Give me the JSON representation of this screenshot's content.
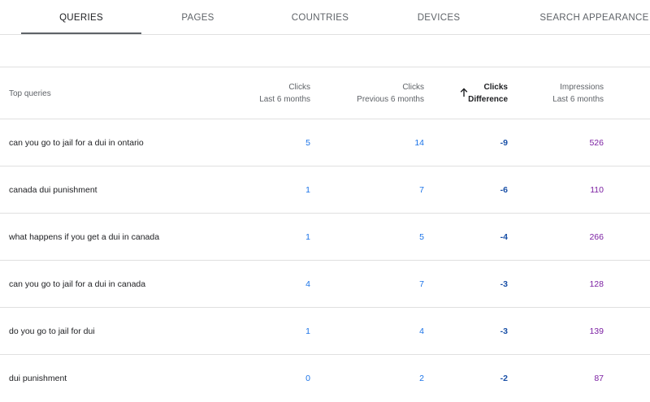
{
  "tabs": [
    {
      "label": "QUERIES",
      "active": true
    },
    {
      "label": "PAGES",
      "active": false
    },
    {
      "label": "COUNTRIES",
      "active": false
    },
    {
      "label": "DEVICES",
      "active": false
    },
    {
      "label": "SEARCH APPEARANCE",
      "active": false
    }
  ],
  "table": {
    "headers": {
      "query": "Top queries",
      "clicks_line1": "Clicks",
      "clicks_line2": "Last 6 months",
      "prev_line1": "Clicks",
      "prev_line2": "Previous 6 months",
      "diff_line1": "Clicks",
      "diff_line2": "Difference",
      "impr_line1": "Impressions",
      "impr_line2": "Last 6 months"
    },
    "sort": {
      "column": "difference",
      "direction": "ascending",
      "icon": "arrow-up-icon"
    },
    "rows": [
      {
        "query": "can you go to jail for a dui in ontario",
        "clicks": "5",
        "prev": "14",
        "diff": "-9",
        "impr": "526"
      },
      {
        "query": "canada dui punishment",
        "clicks": "1",
        "prev": "7",
        "diff": "-6",
        "impr": "110"
      },
      {
        "query": "what happens if you get a dui in canada",
        "clicks": "1",
        "prev": "5",
        "diff": "-4",
        "impr": "266"
      },
      {
        "query": "can you go to jail for a dui in canada",
        "clicks": "4",
        "prev": "7",
        "diff": "-3",
        "impr": "128"
      },
      {
        "query": "do you go to jail for dui",
        "clicks": "1",
        "prev": "4",
        "diff": "-3",
        "impr": "139"
      },
      {
        "query": "dui punishment",
        "clicks": "0",
        "prev": "2",
        "diff": "-2",
        "impr": "87"
      }
    ]
  },
  "colors": {
    "clicks": "#1a73e8",
    "difference": "#174ea6",
    "impressions": "#7b1fa2",
    "divider": "#e0e0e0"
  }
}
